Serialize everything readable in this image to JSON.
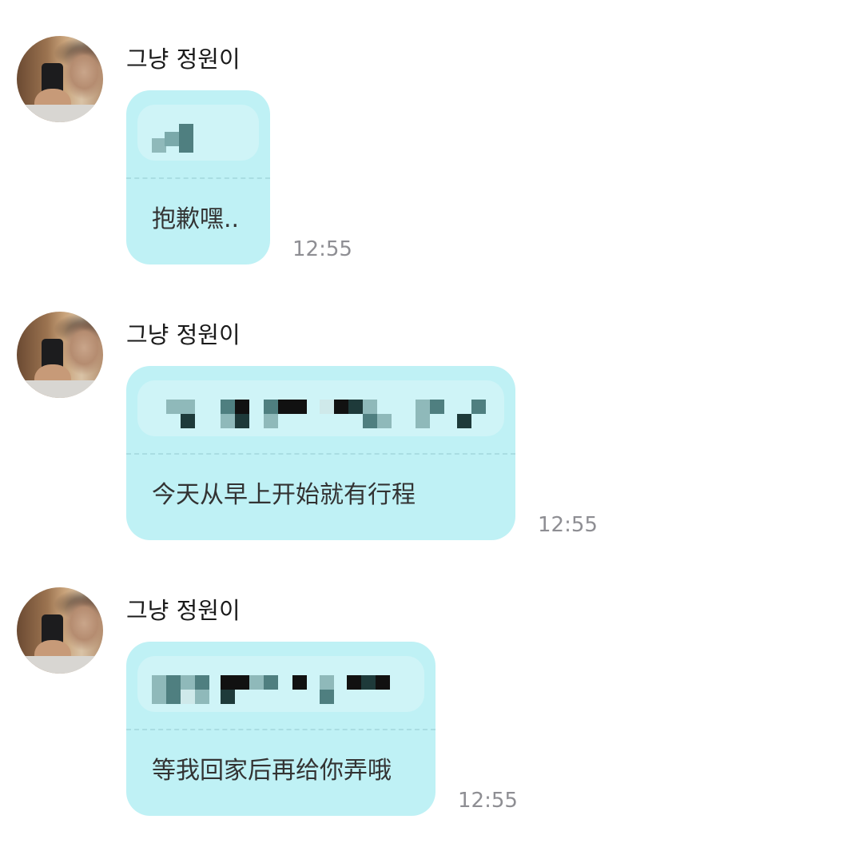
{
  "messages": [
    {
      "sender": "그냥 정원이",
      "translation": "抱歉嘿..",
      "time": "12:55",
      "avatar_icon": "profile-photo",
      "original_text": "[pixelated / censored]"
    },
    {
      "sender": "그냥 정원이",
      "translation": "今天从早上开始就有行程",
      "time": "12:55",
      "avatar_icon": "profile-photo",
      "original_text": "[pixelated / censored]"
    },
    {
      "sender": "그냥 정원이",
      "translation": "等我回家后再给你弄哦",
      "time": "12:55",
      "avatar_icon": "profile-photo",
      "original_text": "[pixelated / censored]"
    }
  ],
  "colors": {
    "bubble": "#bff1f5",
    "divider": "#a9dde2",
    "time": "#8e8e93",
    "name": "#1a1a1a",
    "text": "#333333",
    "pixel_dark": "#1e3a3a",
    "pixel_mid": "#4f7f80",
    "pixel_light": "#8fb9ba"
  }
}
